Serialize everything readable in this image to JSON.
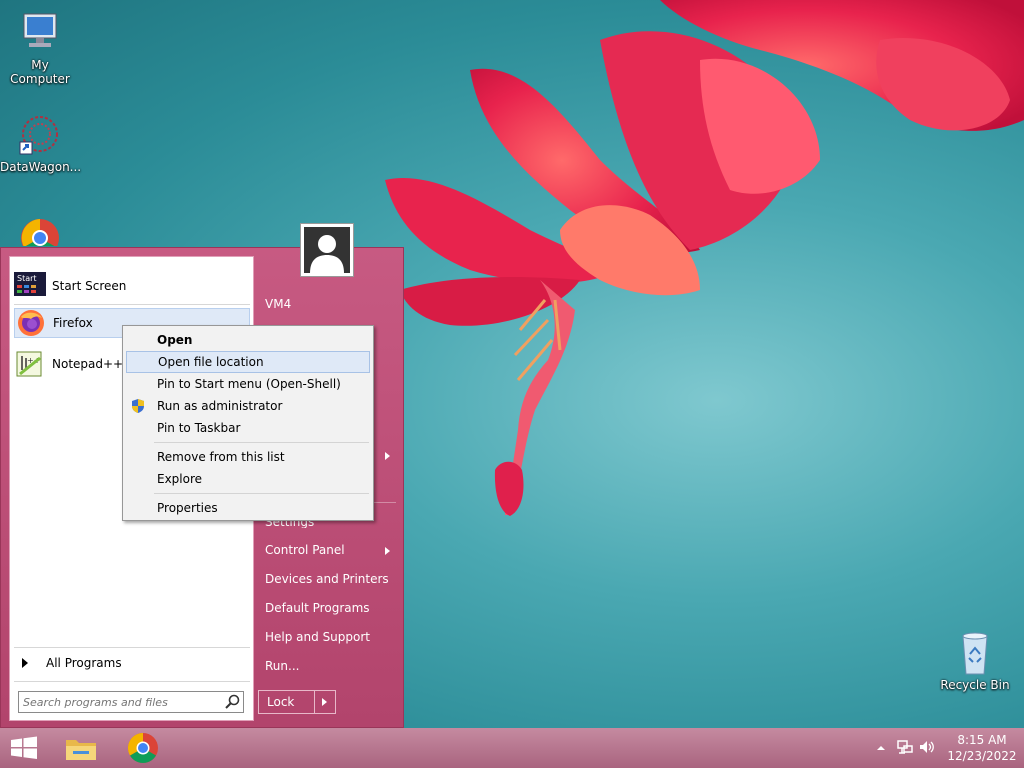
{
  "desktop": {
    "icons": [
      {
        "label": "My Computer"
      },
      {
        "label": "DataWagon..."
      },
      {
        "label": "Recycle Bin"
      }
    ]
  },
  "start_menu": {
    "pinned": [
      {
        "label": "Start Screen",
        "icon": "start-screen-icon"
      },
      {
        "label": "Firefox",
        "icon": "firefox-icon"
      },
      {
        "label": "Notepad++",
        "icon": "notepad-plus-icon"
      }
    ],
    "all_programs": "All Programs",
    "search_placeholder": "Search programs and files",
    "right": {
      "user": "VM4",
      "settings": "Settings",
      "control_panel": "Control Panel",
      "devices": "Devices and Printers",
      "default_programs": "Default Programs",
      "help": "Help and Support",
      "run": "Run..."
    },
    "lock_label": "Lock"
  },
  "context_menu": {
    "items": [
      {
        "label": "Open"
      },
      {
        "label": "Open file location"
      },
      {
        "label": "Pin to Start menu (Open-Shell)"
      },
      {
        "label": "Run as administrator"
      },
      {
        "label": "Pin to Taskbar"
      },
      {
        "label": "Remove from this list"
      },
      {
        "label": "Explore"
      },
      {
        "label": "Properties"
      }
    ]
  },
  "taskbar": {
    "time": "8:15 AM",
    "date": "12/23/2022"
  },
  "colors": {
    "start_menu": "#b8486f",
    "highlight": "#dfe9f7",
    "taskbar": "#b5728c"
  }
}
